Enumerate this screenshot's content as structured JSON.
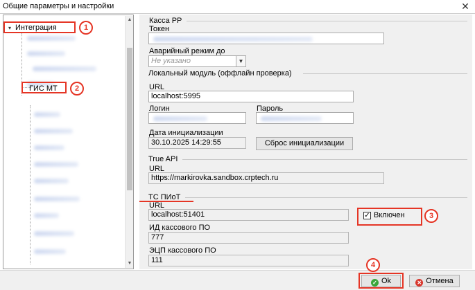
{
  "window": {
    "title": "Общие параметры и настройки",
    "close_glyph": "✕"
  },
  "tree": {
    "integration_label": "Интеграция",
    "gis_mt_label": "ГИС МТ",
    "expand_glyph": "▾"
  },
  "kassa": {
    "group_label": "Касса РР",
    "token_label": "Токен",
    "emergency_label": "Аварийный режим до",
    "emergency_placeholder": "Не указано",
    "combo_arrow": "▼"
  },
  "local_module": {
    "group_label": "Локальный модуль (оффлайн проверка)",
    "url_label": "URL",
    "url_value": "localhost:5995",
    "login_label": "Логин",
    "password_label": "Пароль",
    "init_date_label": "Дата инициализации",
    "init_date_value": "30.10.2025 14:29:55",
    "reset_button": "Сброс инициализации"
  },
  "true_api": {
    "group_label": "True API",
    "url_label": "URL",
    "url_value": "https://markirovka.sandbox.crptech.ru"
  },
  "ts_piot": {
    "group_label": "ТС ПИоТ",
    "url_label": "URL",
    "url_value": "localhost:51401",
    "enabled_label": "Включен",
    "check_glyph": "✓",
    "kass_id_label": "ИД кассового ПО",
    "kass_id_value": "777",
    "ecp_label": "ЭЦП кассового ПО",
    "ecp_value": "111"
  },
  "footer": {
    "ok_label": "Ok",
    "cancel_label": "Отмена"
  },
  "annotations": {
    "step1": "1",
    "step2": "2",
    "step3": "3",
    "step4": "4"
  },
  "colors": {
    "annotation_red": "#e53525",
    "ok_icon_green": "#3aa63a",
    "cancel_icon_red": "#d8382e"
  }
}
